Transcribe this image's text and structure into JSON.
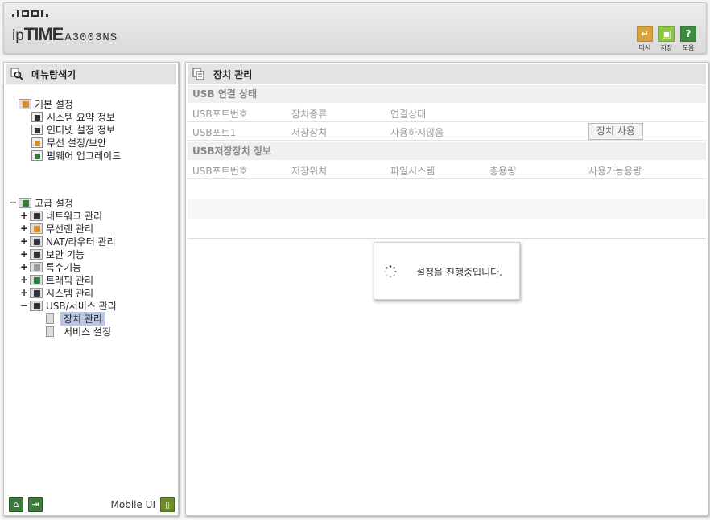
{
  "header": {
    "brand_prefix": "ip",
    "brand_main": "TIME",
    "model": "A3003NS",
    "toolbar": [
      {
        "label": "다시",
        "icon": "refresh-icon",
        "color": "#d9a23a"
      },
      {
        "label": "저장",
        "icon": "save-icon",
        "color": "#8dc63f"
      },
      {
        "label": "도움",
        "icon": "help-icon",
        "color": "#3c8a3c"
      }
    ]
  },
  "sidebar": {
    "title": "메뉴탐색기",
    "basic": {
      "label": "기본 설정",
      "items": [
        "시스템 요약 정보",
        "인터넷 설정 정보",
        "무선 설정/보안",
        "펌웨어 업그레이드"
      ]
    },
    "advanced": {
      "label": "고급 설정",
      "expander": "−",
      "items": [
        {
          "label": "네트워크 관리",
          "expander": "+"
        },
        {
          "label": "무선랜 관리",
          "expander": "+"
        },
        {
          "label": "NAT/라우터 관리",
          "expander": "+"
        },
        {
          "label": "보안 기능",
          "expander": "+"
        },
        {
          "label": "특수기능",
          "expander": "+"
        },
        {
          "label": "트래픽 관리",
          "expander": "+"
        },
        {
          "label": "시스템 관리",
          "expander": "+"
        },
        {
          "label": "USB/서비스 관리",
          "expander": "−"
        }
      ],
      "usb_children": [
        "장치 관리",
        "서비스 설정"
      ]
    },
    "mobile_label": "Mobile UI"
  },
  "main": {
    "title": "장치 관리",
    "usb_status": {
      "title": "USB 연결 상태",
      "headers": [
        "USB포트번호",
        "장치종류",
        "연결상태"
      ],
      "rows": [
        {
          "port": "USB포트1",
          "type": "저장장치",
          "status": "사용하지않음",
          "button": "장치 사용"
        }
      ]
    },
    "storage": {
      "title": "USB저장장치 정보",
      "headers": [
        "USB포트번호",
        "저장위치",
        "파일시스템",
        "총용량",
        "사용가능용량"
      ]
    }
  },
  "dialog": {
    "message": "설정을 진행중입니다."
  }
}
